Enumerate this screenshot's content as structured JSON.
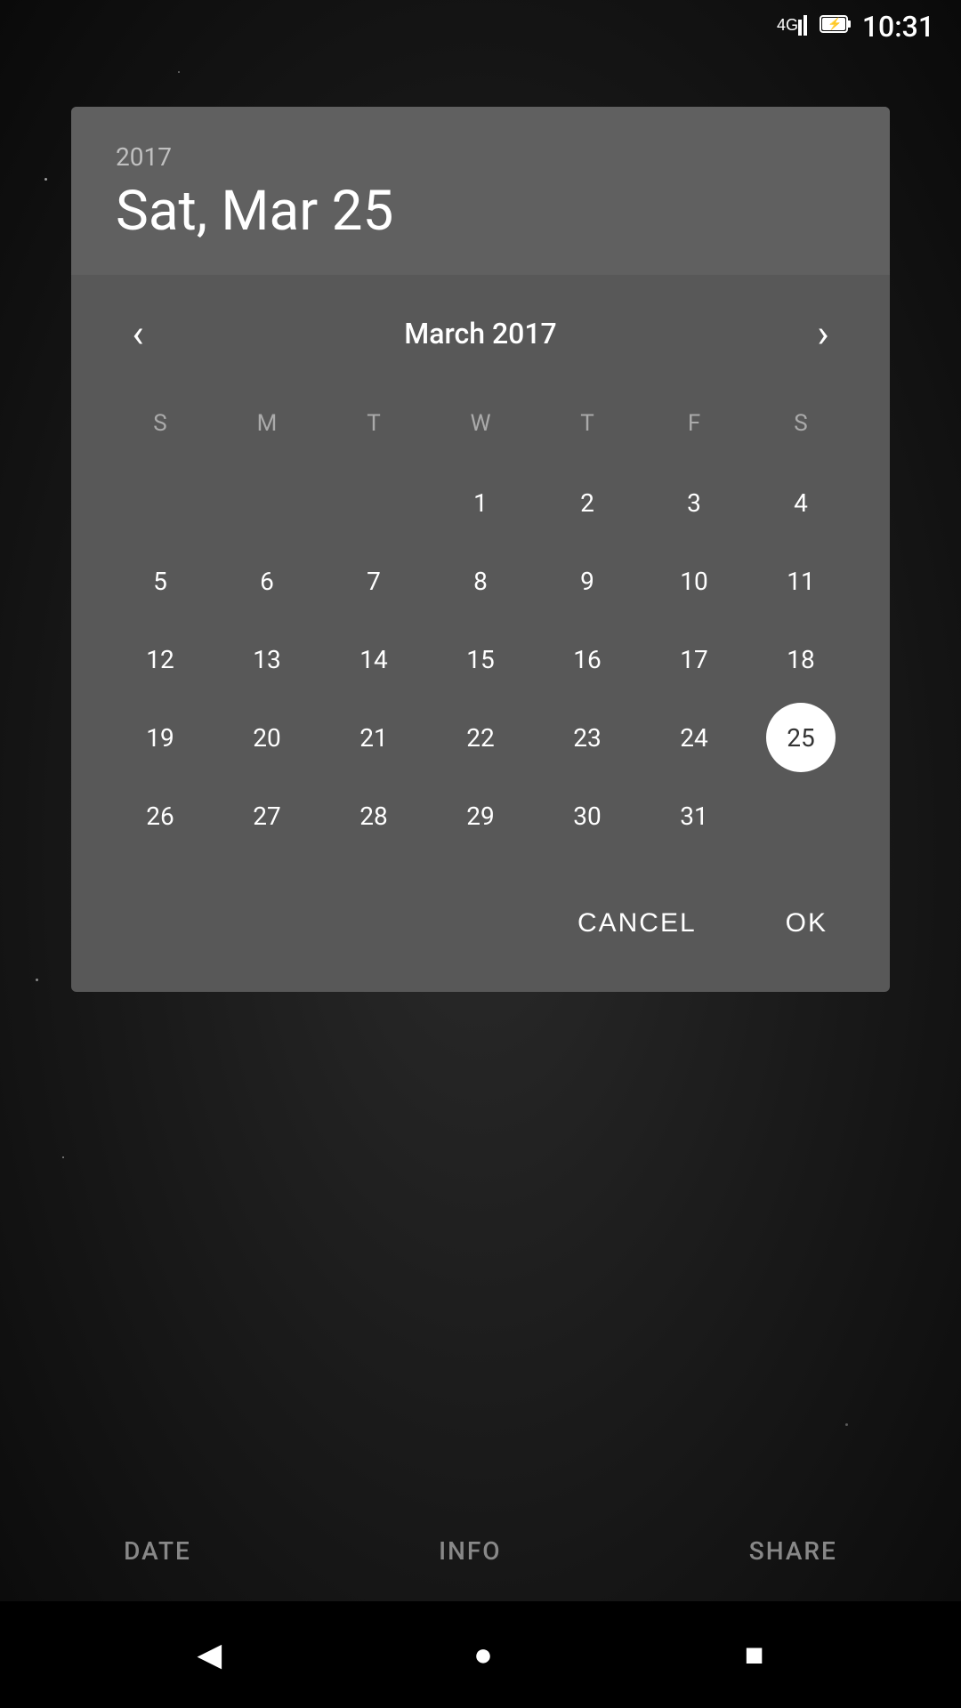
{
  "statusBar": {
    "signal": "4G",
    "time": "10:31"
  },
  "dialog": {
    "year": "2017",
    "dateDisplay": "Sat, Mar 25",
    "monthYear": "March 2017",
    "selectedDay": 25,
    "prevArrow": "‹",
    "nextArrow": "›"
  },
  "calendar": {
    "dayHeaders": [
      "S",
      "M",
      "T",
      "W",
      "T",
      "F",
      "S"
    ],
    "weeks": [
      [
        null,
        null,
        null,
        1,
        2,
        3,
        4
      ],
      [
        5,
        6,
        7,
        8,
        9,
        10,
        11
      ],
      [
        12,
        13,
        14,
        15,
        16,
        17,
        18
      ],
      [
        19,
        20,
        21,
        22,
        23,
        24,
        25
      ],
      [
        26,
        27,
        28,
        29,
        30,
        31,
        null
      ]
    ]
  },
  "buttons": {
    "cancel": "CANCEL",
    "ok": "OK"
  },
  "bottomTabs": {
    "date": "DATE",
    "info": "INFO",
    "share": "SHARE"
  },
  "systemNav": {
    "back": "◀",
    "home": "●",
    "recents": "■"
  },
  "colors": {
    "dialogBg": "#585858",
    "headerBg": "#606060",
    "selectedCircle": "#ffffff",
    "textWhite": "#ffffff",
    "textGray": "#aaaaaa"
  }
}
